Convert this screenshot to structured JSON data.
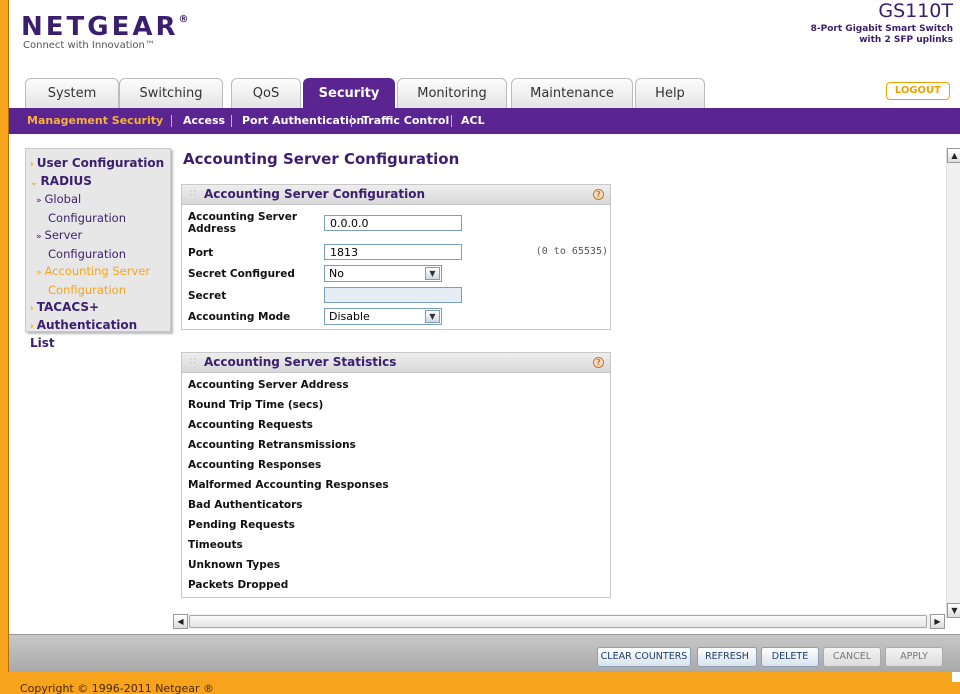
{
  "header": {
    "brand": "NETGEAR",
    "tagline": "Connect with Innovation™",
    "model": "GS110T",
    "model_desc_1": "8-Port Gigabit Smart Switch",
    "model_desc_2": "with 2 SFP uplinks",
    "logout": "LOGOUT"
  },
  "tabs": [
    {
      "label": "System"
    },
    {
      "label": "Switching"
    },
    {
      "label": "QoS"
    },
    {
      "label": "Security"
    },
    {
      "label": "Monitoring"
    },
    {
      "label": "Maintenance"
    },
    {
      "label": "Help"
    }
  ],
  "active_tab": "Security",
  "submenu": [
    {
      "label": "Management Security"
    },
    {
      "label": "Access"
    },
    {
      "label": "Port Authentication"
    },
    {
      "label": "Traffic Control"
    },
    {
      "label": "ACL"
    }
  ],
  "leftnav": {
    "user_config": "User Configuration",
    "radius": "RADIUS",
    "global_1": "Global",
    "global_2": "Configuration",
    "server_1": "Server",
    "server_2": "Configuration",
    "acct_1": "Accounting Server",
    "acct_2": "Configuration",
    "tacacs": "TACACS+",
    "auth_list": "Authentication List"
  },
  "page_title": "Accounting Server Configuration",
  "config_panel": {
    "title": "Accounting Server Configuration",
    "address_label_1": "Accounting Server",
    "address_label_2": "Address",
    "address_value": "0.0.0.0",
    "port_label": "Port",
    "port_value": "1813",
    "port_range": "(0 to 65535)",
    "secret_configured_label": "Secret Configured",
    "secret_configured_value": "No",
    "secret_label": "Secret",
    "secret_value": "",
    "mode_label": "Accounting Mode",
    "mode_value": "Disable"
  },
  "stats_panel": {
    "title": "Accounting Server Statistics",
    "rows": [
      "Accounting Server Address",
      "Round Trip Time (secs)",
      "Accounting Requests",
      "Accounting Retransmissions",
      "Accounting Responses",
      "Malformed Accounting Responses",
      "Bad Authenticators",
      "Pending Requests",
      "Timeouts",
      "Unknown Types",
      "Packets Dropped"
    ]
  },
  "buttons": {
    "clear_counters": "CLEAR COUNTERS",
    "refresh": "REFRESH",
    "delete": "DELETE",
    "cancel": "CANCEL",
    "apply": "APPLY"
  },
  "footer": {
    "copyright": "Copyright © 1996-2011 Netgear ®"
  },
  "colors": {
    "brand_purple": "#5a2491",
    "accent_orange": "#f7a31c"
  }
}
